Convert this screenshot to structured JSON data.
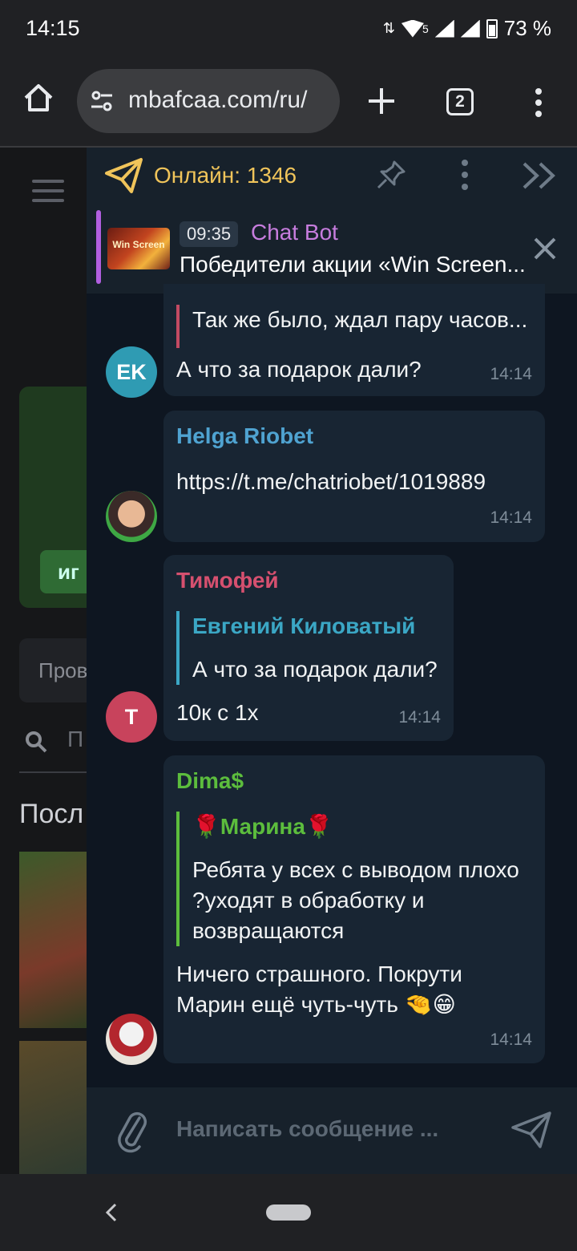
{
  "status_bar": {
    "time": "14:15",
    "battery": "73 %",
    "network_badge": "5"
  },
  "browser": {
    "url": "mbafcaa.com/ru/",
    "tab_count": "2"
  },
  "background_site": {
    "card_button": "иг",
    "input_placeholder": "Пров",
    "search_text": "П",
    "heading": "Посл"
  },
  "chat": {
    "online_label": "Онлайн: 1346",
    "pinned": {
      "time": "09:35",
      "sender": "Chat Bot",
      "text": "Победители акции «Win Screen...",
      "thumb_label": "Win Screen"
    },
    "messages": [
      {
        "quote_text": "Так же было, ждал пару часов...",
        "text": "А что за подарок дали?",
        "time": "14:14",
        "avatar_initials": "EK",
        "avatar_color": "#2f9bb3"
      },
      {
        "author": "Helga Riobet",
        "author_color": "#4fa3d1",
        "text": "https://t.me/chatriobet/1019889",
        "time": "14:14"
      },
      {
        "author": "Тимофей",
        "author_color": "#d6506f",
        "quote_author": "Евгений Киловатый",
        "quote_color": "#3ba7c5",
        "quote_text": "А что за подарок дали?",
        "text": "10к с 1х",
        "time": "14:14",
        "avatar_initials": "T",
        "avatar_color": "#c8435c"
      },
      {
        "author": "Dima$",
        "author_color": "#5cbd3d",
        "quote_author": "🌹Марина🌹",
        "quote_color": "#5cbd3d",
        "quote_text_line1": "Ребята у всех с выводом плохо",
        "quote_text_line2": "?уходят в обработку и",
        "quote_text_line3": "возвращаются",
        "text_line1": "Ничего страшного. Покрути",
        "text_line2": "Марин ещё чуть-чуть 🤏😁",
        "time": "14:14"
      }
    ],
    "composer_placeholder": "Написать сообщение ..."
  }
}
